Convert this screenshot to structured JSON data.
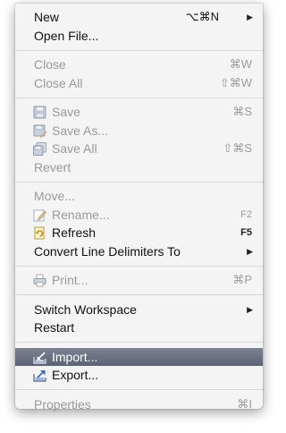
{
  "menu": {
    "groups": [
      {
        "items": [
          {
            "label": "New",
            "shortcut": "⌥⌘N",
            "submenu": true,
            "arrow": "▶",
            "enabled": true
          },
          {
            "label": "Open File...",
            "shortcut": "",
            "enabled": true
          }
        ]
      },
      {
        "items": [
          {
            "label": "Close",
            "shortcut": "⌘W",
            "enabled": false
          },
          {
            "label": "Close All",
            "shortcut": "⇧⌘W",
            "enabled": false
          }
        ]
      },
      {
        "items": [
          {
            "label": "Save",
            "shortcut": "⌘S",
            "enabled": false,
            "icon": "floppy-disk-icon"
          },
          {
            "label": "Save As...",
            "shortcut": "",
            "enabled": false,
            "icon": "save-as-icon"
          },
          {
            "label": "Save All",
            "shortcut": "⇧⌘S",
            "enabled": false,
            "icon": "save-all-icon"
          },
          {
            "label": "Revert",
            "shortcut": "",
            "enabled": false
          }
        ]
      },
      {
        "items": [
          {
            "label": "Move...",
            "shortcut": "",
            "enabled": false
          },
          {
            "label": "Rename...",
            "shortcut": "F2",
            "enabled": false,
            "icon": "rename-icon"
          },
          {
            "label": "Refresh",
            "shortcut": "F5",
            "enabled": true,
            "icon": "refresh-icon"
          },
          {
            "label": "Convert Line Delimiters To",
            "shortcut": "",
            "submenu": true,
            "arrow": "▶",
            "enabled": true
          }
        ]
      },
      {
        "items": [
          {
            "label": "Print...",
            "shortcut": "⌘P",
            "enabled": false,
            "icon": "printer-icon"
          }
        ]
      },
      {
        "items": [
          {
            "label": "Switch Workspace",
            "shortcut": "",
            "submenu": true,
            "arrow": "▶",
            "enabled": true
          },
          {
            "label": "Restart",
            "shortcut": "",
            "enabled": true
          }
        ]
      },
      {
        "items": [
          {
            "label": "Import...",
            "shortcut": "",
            "enabled": true,
            "selected": true,
            "icon": "import-icon"
          },
          {
            "label": "Export...",
            "shortcut": "",
            "enabled": true,
            "icon": "export-icon"
          }
        ]
      },
      {
        "items": [
          {
            "label": "Properties",
            "shortcut": "⌘I",
            "enabled": false
          }
        ]
      }
    ]
  },
  "colors": {
    "menu_background": "#f4f4f4",
    "text_enabled": "#111111",
    "text_disabled": "#9a9a9a",
    "selection_top": "#7b8292",
    "selection_bottom": "#5d6374",
    "separator": "#d6d6d6"
  }
}
